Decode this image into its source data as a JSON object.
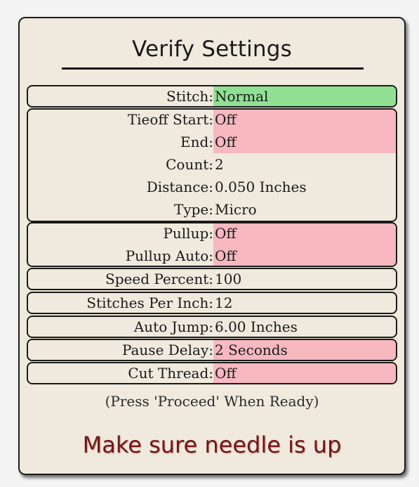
{
  "title": "Verify Settings",
  "groups": [
    {
      "rows": [
        {
          "label": "Stitch:",
          "value": "Normal",
          "highlight": "green"
        }
      ]
    },
    {
      "rows": [
        {
          "label": "Tieoff Start:",
          "value": "Off",
          "highlight": "red"
        },
        {
          "label": "End:",
          "value": "Off",
          "highlight": "red"
        },
        {
          "label": "Count:",
          "value": "2",
          "highlight": "none"
        },
        {
          "label": "Distance:",
          "value": "0.050  Inches",
          "highlight": "none"
        },
        {
          "label": "Type:",
          "value": "Micro",
          "highlight": "none"
        }
      ]
    },
    {
      "rows": [
        {
          "label": "Pullup:",
          "value": "Off",
          "highlight": "red"
        },
        {
          "label": "Pullup Auto:",
          "value": "Off",
          "highlight": "red"
        }
      ]
    },
    {
      "rows": [
        {
          "label": "Speed Percent:",
          "value": "100",
          "highlight": "none"
        }
      ]
    },
    {
      "rows": [
        {
          "label": "Stitches Per Inch:",
          "value": "12",
          "highlight": "none"
        }
      ]
    },
    {
      "rows": [
        {
          "label": "Auto Jump:",
          "value": "6.00  Inches",
          "highlight": "none"
        }
      ]
    },
    {
      "rows": [
        {
          "label": "Pause Delay:",
          "value": "2 Seconds",
          "highlight": "red"
        }
      ]
    },
    {
      "rows": [
        {
          "label": "Cut Thread:",
          "value": "Off",
          "highlight": "red"
        }
      ]
    }
  ],
  "hint": "(Press 'Proceed' When Ready)",
  "warning": "Make sure needle is up",
  "colors": {
    "green_highlight": "#90e094",
    "red_highlight": "#f7b8c0",
    "warning_text": "#7a1416",
    "panel_background": "#efeadd"
  }
}
